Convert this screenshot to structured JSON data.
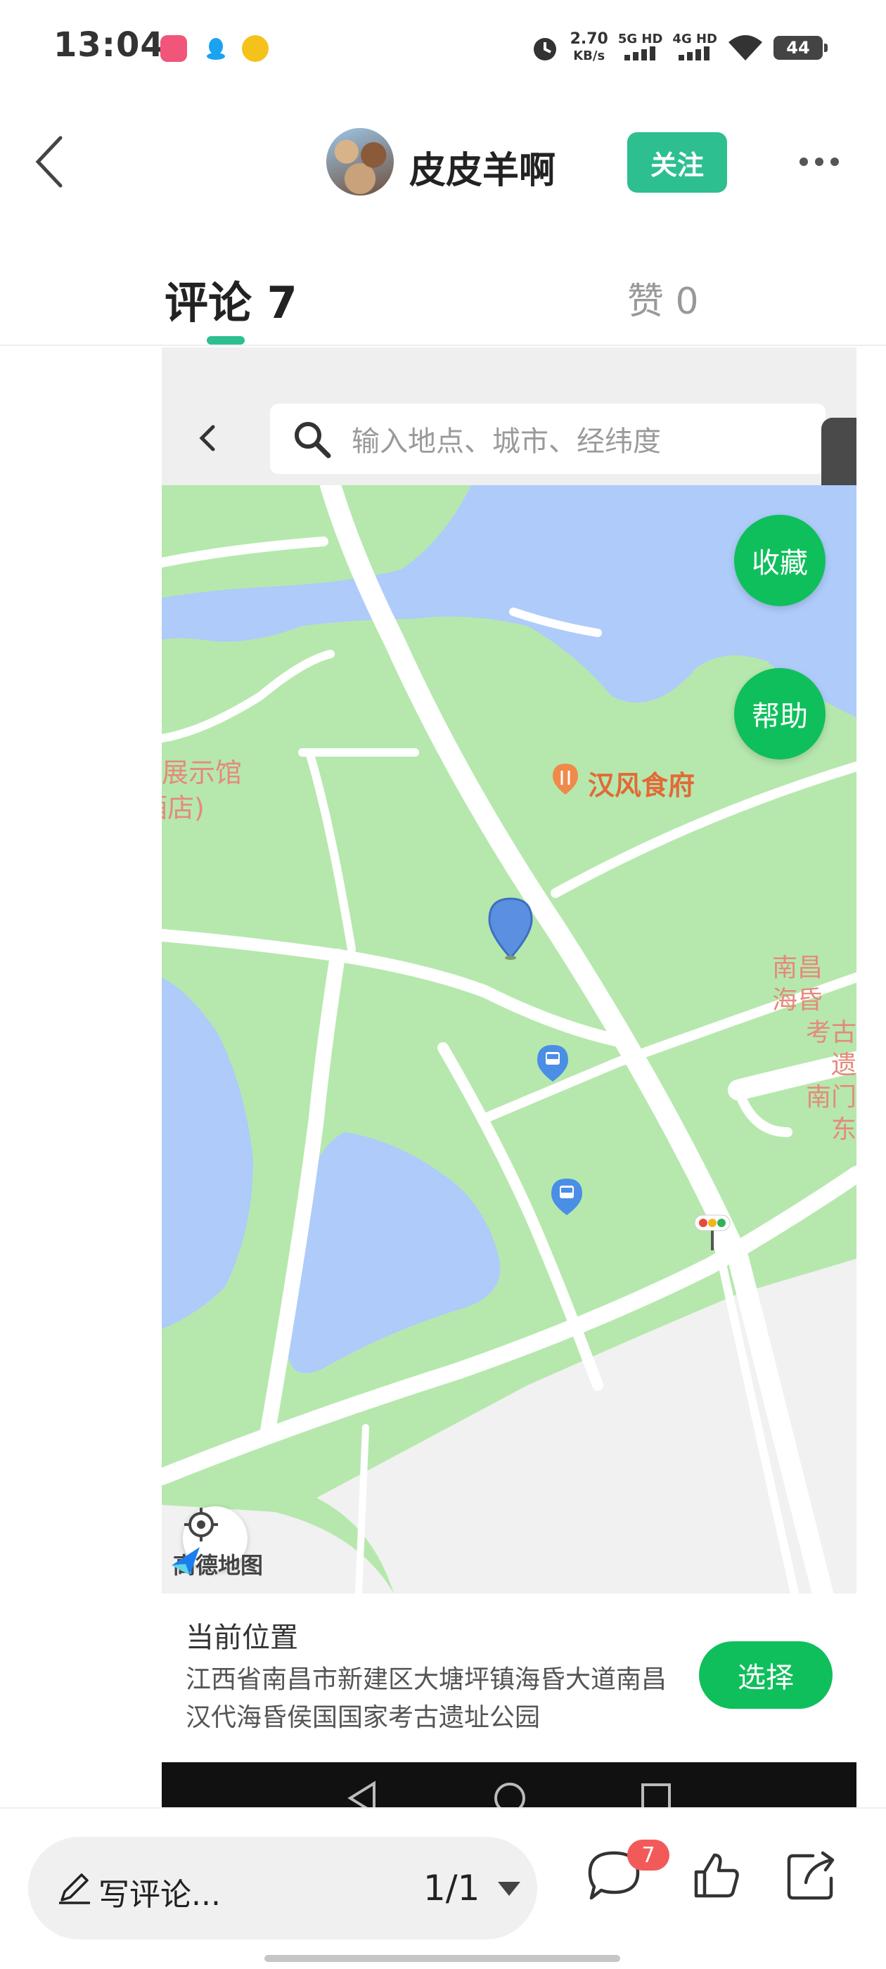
{
  "status_bar": {
    "time": "13:04",
    "net_speed_value": "2.70",
    "net_speed_unit": "KB/s",
    "signal_1": "5G HD",
    "signal_2": "4G HD",
    "battery": "44"
  },
  "header": {
    "username": "皮皮羊啊",
    "follow_label": "关注"
  },
  "tabs": {
    "comments_label": "评论 7",
    "likes_label": "赞 0"
  },
  "embedded_map": {
    "search_placeholder": "输入地点、城市、经纬度",
    "collect_label": "收藏",
    "help_label": "帮助",
    "poi_restaurant": "汉风食府",
    "left_label_line1": "展示馆",
    "left_label_line2": "酒店)",
    "right_label_line1": "南昌",
    "right_label_line2": "海昏",
    "right_label_line3": "考古遗",
    "right_label_line4": "南门东",
    "logo_text": "高德地图",
    "current_location_title": "当前位置",
    "current_location_address": "江西省南昌市新建区大塘坪镇海昏大道南昌汉代海昏侯国国家考古遗址公园",
    "select_label": "选择",
    "colors": {
      "land": "#b6e8ad",
      "water": "#aecbfa",
      "road": "#ffffff",
      "accent": "#0fbf5c"
    }
  },
  "bottom_bar": {
    "comment_placeholder": "写评论...",
    "page_indicator": "1/1",
    "comment_badge": "7"
  },
  "colors": {
    "brand": "#2ebf91",
    "badge": "#f25a5a"
  }
}
